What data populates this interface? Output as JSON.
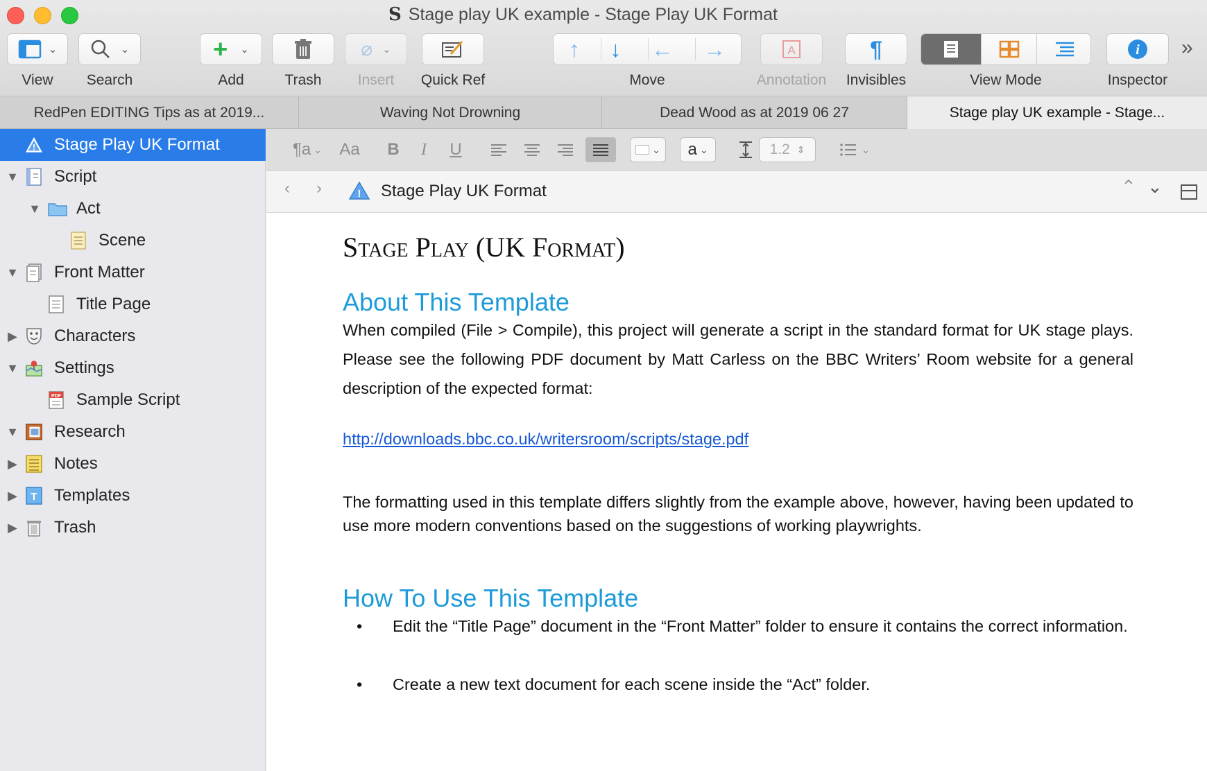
{
  "window": {
    "title": "Stage play UK example - Stage Play UK Format",
    "app_glyph": "S"
  },
  "toolbar": {
    "view": "View",
    "search": "Search",
    "add": "Add",
    "trash": "Trash",
    "insert": "Insert",
    "quick_ref": "Quick Ref",
    "move": "Move",
    "annotation": "Annotation",
    "invisibles": "Invisibles",
    "view_mode": "View Mode",
    "inspector": "Inspector",
    "overflow": "»"
  },
  "tabs": [
    {
      "label": "RedPen EDITING Tips as at 2019..."
    },
    {
      "label": "Waving Not Drowning"
    },
    {
      "label": "Dead Wood as at 2019 06 27"
    },
    {
      "label": "Stage play UK example - Stage..."
    }
  ],
  "binder": {
    "items": [
      {
        "label": "Stage Play UK Format",
        "icon": "warning-icon"
      },
      {
        "label": "Script",
        "icon": "script-icon"
      },
      {
        "label": "Act",
        "icon": "folder-icon"
      },
      {
        "label": "Scene",
        "icon": "index-card-icon"
      },
      {
        "label": "Front Matter",
        "icon": "front-matter-icon"
      },
      {
        "label": "Title Page",
        "icon": "document-icon"
      },
      {
        "label": "Characters",
        "icon": "mask-icon"
      },
      {
        "label": "Settings",
        "icon": "map-pin-icon"
      },
      {
        "label": "Sample Script",
        "icon": "pdf-icon"
      },
      {
        "label": "Research",
        "icon": "research-icon"
      },
      {
        "label": "Notes",
        "icon": "notebook-icon"
      },
      {
        "label": "Templates",
        "icon": "template-icon"
      },
      {
        "label": "Trash",
        "icon": "trash-icon"
      }
    ]
  },
  "formatbar": {
    "para_style": "¶a",
    "font": "Aa",
    "bold": "B",
    "italic": "I",
    "underline": "U",
    "text_color_value": "a",
    "line_spacing": "1.2"
  },
  "header": {
    "title": "Stage Play UK Format"
  },
  "document": {
    "title": "Stage Play (UK Format)",
    "h_about": "About This Template",
    "p_about": "When compiled (File > Compile), this project will generate a script in the standard format for UK stage plays.  Please see the following PDF document by Matt Carless on the BBC Writers’ Room website for a general description of the expected format:",
    "link": "http://downloads.bbc.co.uk/writersroom/scripts/stage.pdf",
    "p_formatting": "The formatting used in this template differs slightly from the example above, however, having been updated to use more modern conventions based on the suggestions of working playwrights.",
    "h_howto": "How To Use This Template",
    "bullets": [
      "Edit the “Title Page” document in the “Front Matter” folder to ensure it contains the correct information.",
      "Create a new text document for each scene inside the “Act” folder."
    ],
    "bullet_char": "•"
  },
  "colors": {
    "accent": "#2a7de9",
    "heading": "#1d9bd9",
    "link": "#1558d6"
  }
}
